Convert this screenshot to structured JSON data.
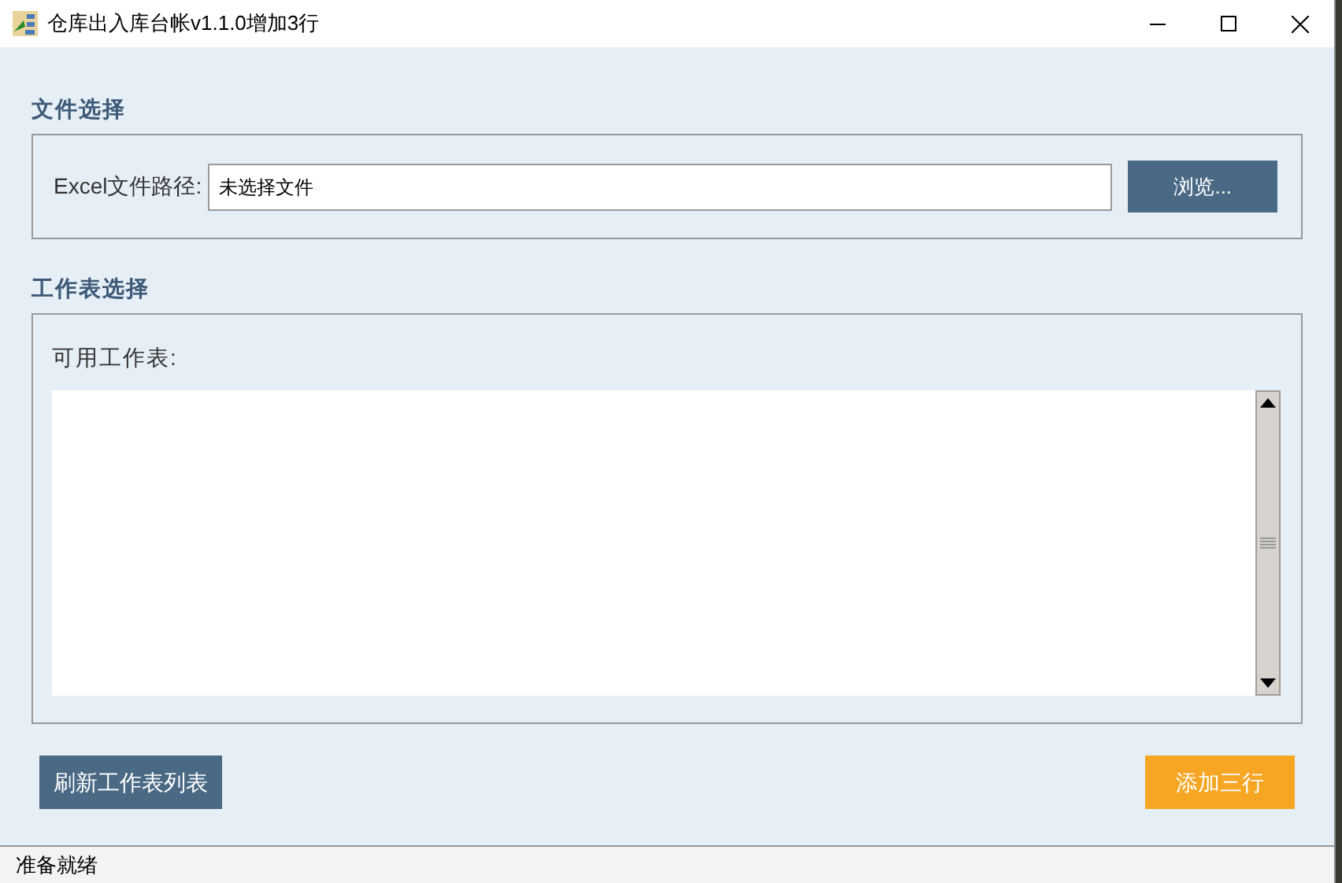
{
  "window": {
    "title": "仓库出入库台帐v1.1.0增加3行"
  },
  "file_section": {
    "heading": "文件选择",
    "path_label": "Excel文件路径:",
    "path_value": "未选择文件",
    "browse_button": "浏览..."
  },
  "sheet_section": {
    "heading": "工作表选择",
    "list_label": "可用工作表:"
  },
  "buttons": [
    {
      "label": "刷新工作表列表",
      "kind": "primary"
    },
    {
      "label": "添加三行",
      "kind": "accent"
    }
  ],
  "status_bar": "准备就绪"
}
